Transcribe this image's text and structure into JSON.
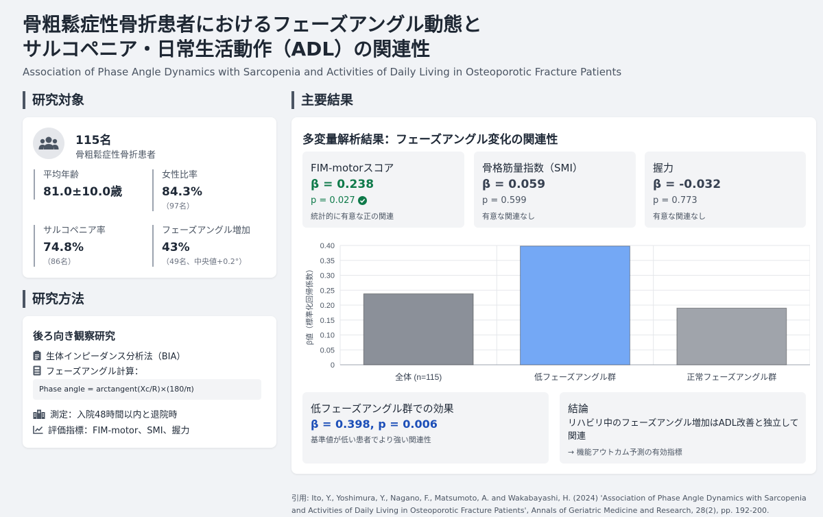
{
  "header": {
    "title_line1": "骨粗鬆症性骨折患者におけるフェーズアングル動態と",
    "title_line2": "サルコペニア・日常生活動作（ADL）の関連性",
    "subtitle": "Association of Phase Angle Dynamics with Sarcopenia and Activities of Daily Living in Osteoporotic Fracture Patients"
  },
  "subjects": {
    "heading": "研究対象",
    "count": "115名",
    "description": "骨粗鬆症性骨折患者",
    "stats": [
      {
        "label": "平均年齢",
        "value": "81.0±10.0歳",
        "sub": ""
      },
      {
        "label": "女性比率",
        "value": "84.3%",
        "sub": "（97名）"
      },
      {
        "label": "サルコペニア率",
        "value": "74.8%",
        "sub": "（86名）"
      },
      {
        "label": "フェーズアングル増加",
        "value": "43%",
        "sub": "（49名、中央値+0.2°）"
      }
    ]
  },
  "methods": {
    "heading": "研究方法",
    "design": "後ろ向き観察研究",
    "bia": "生体インピーダンス分析法（BIA）",
    "calc_label": "フェーズアングル計算：",
    "formula": "Phase angle = arctangent(Xc/R)×(180/π)",
    "measurement": "測定：入院48時間以内と退院時",
    "indicators": "評価指標：FIM-motor、SMI、握力"
  },
  "results": {
    "heading": "主要結果",
    "panel_title": "多変量解析結果：フェーズアングル変化の関連性",
    "metrics": [
      {
        "name": "FIM-motorスコア",
        "beta": "β = 0.238",
        "p": "p = 0.027",
        "note": "統計的に有意な正の関連",
        "significant": true
      },
      {
        "name": "骨格筋量指数（SMI）",
        "beta": "β = 0.059",
        "p": "p = 0.599",
        "note": "有意な関連なし",
        "significant": false
      },
      {
        "name": "握力",
        "beta": "β = -0.032",
        "p": "p = 0.773",
        "note": "有意な関連なし",
        "significant": false
      }
    ],
    "low_group": {
      "title": "低フェーズアングル群での効果",
      "stat": "β = 0.398, p = 0.006",
      "note": "基準値が低い患者でより強い関連性"
    },
    "conclusion": {
      "title": "結論",
      "text": "リハビリ中のフェーズアングル増加はADL改善と独立して関連",
      "note": "→ 機能アウトカム予測の有効指標"
    }
  },
  "colors": {
    "significant": "#0f7a4a",
    "accent_blue": "#1d4fb8",
    "bar_gray": "#8b9099",
    "bar_blue": "#74a8f5",
    "bar_light_gray": "#a0a4ab"
  },
  "icons": {
    "avatar": "users-icon",
    "bia": "clipboard-icon",
    "calc": "calculator-icon",
    "measure": "hospital-icon",
    "indicator": "chart-line-icon",
    "significant": "check-circle-icon"
  },
  "chart_data": {
    "type": "bar",
    "categories": [
      "全体 (n=115)",
      "低フェーズアングル群",
      "正常フェーズアングル群"
    ],
    "values": [
      0.238,
      0.398,
      0.19
    ],
    "bar_colors": [
      "#8b9099",
      "#74a8f5",
      "#a0a4ab"
    ],
    "ylabel": "β値（標準化回帰係数）",
    "ylim": [
      0,
      0.4
    ],
    "yticks": [
      "0",
      "0.05",
      "0.10",
      "0.15",
      "0.20",
      "0.25",
      "0.30",
      "0.35",
      "0.40"
    ],
    "grid": true
  },
  "citation": "引用: Ito, Y., Yoshimura, Y., Nagano, F., Matsumoto, A. and Wakabayashi, H. (2024) 'Association of Phase Angle Dynamics with Sarcopenia and Activities of Daily Living in Osteoporotic Fracture Patients', Annals of Geriatric Medicine and Research, 28(2), pp. 192-200."
}
